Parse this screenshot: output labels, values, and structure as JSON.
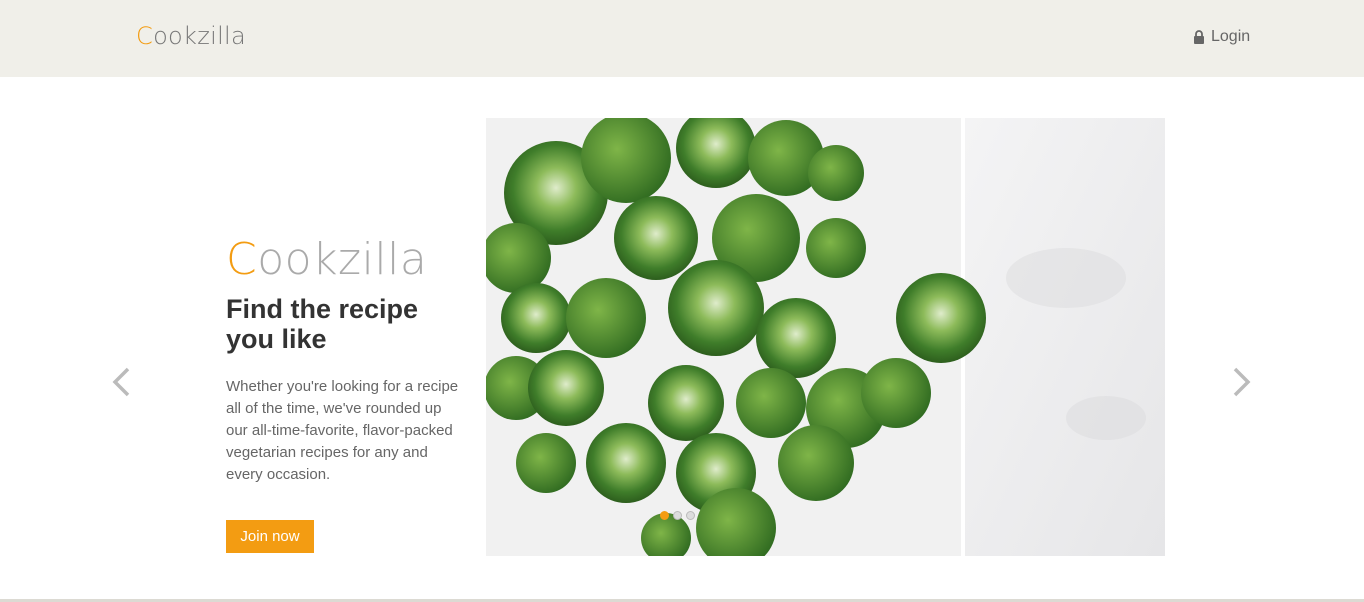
{
  "header": {
    "logo_first": "C",
    "logo_rest": "ookzilla",
    "login_label": "Login",
    "login_icon": "lock-icon"
  },
  "hero": {
    "brand_first": "C",
    "brand_rest": "ookzilla",
    "headline": "Find the recipe you like",
    "description": "Whether you're looking for a recipe all of the time, we've rounded up our all-time-favorite, flavor-packed vegetarian recipes for any and every occasion.",
    "cta_label": "Join now"
  },
  "carousel": {
    "prev_icon": "chevron-left-icon",
    "next_icon": "chevron-right-icon",
    "slide_count": 3,
    "active_slide": 1,
    "image_subject": "brussels-sprouts-photo"
  },
  "colors": {
    "accent": "#f39c12",
    "header_bg": "#f0efe9",
    "headline": "#333333",
    "body_text": "#666666"
  }
}
